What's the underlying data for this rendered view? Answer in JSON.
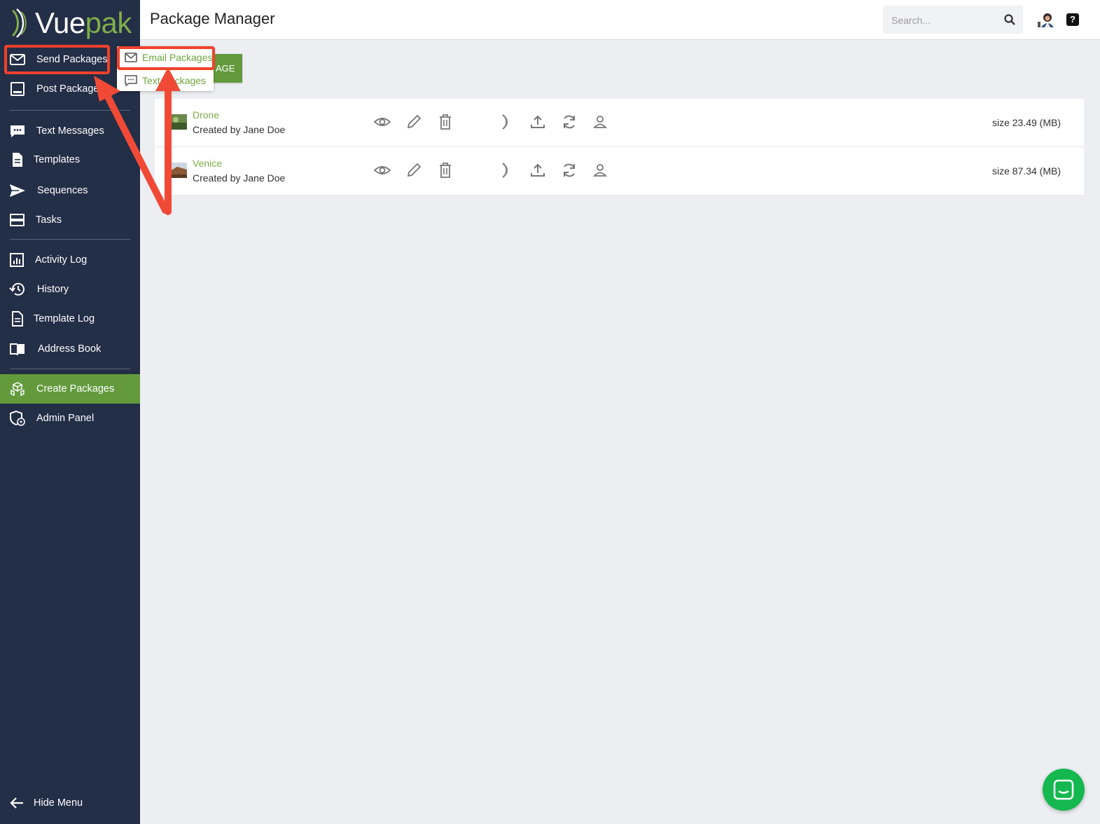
{
  "app": {
    "brand_first": "Vue",
    "brand_second": "pak"
  },
  "header": {
    "title": "Package Manager",
    "search_placeholder": "Search...",
    "help_label": "?"
  },
  "sidebar": {
    "items": [
      {
        "label": "Send Packages",
        "icon": "mail-icon"
      },
      {
        "label": "Post Packages",
        "icon": "monitor-icon"
      },
      {
        "label": "Text Messages",
        "icon": "chat-icon"
      },
      {
        "label": "Templates",
        "icon": "document-icon"
      },
      {
        "label": "Sequences",
        "icon": "send-icon"
      },
      {
        "label": "Tasks",
        "icon": "tasks-icon"
      },
      {
        "label": "Activity Log",
        "icon": "chart-icon"
      },
      {
        "label": "History",
        "icon": "history-icon"
      },
      {
        "label": "Template Log",
        "icon": "document-icon"
      },
      {
        "label": "Address Book",
        "icon": "book-icon"
      },
      {
        "label": "Create Packages",
        "icon": "boxes-icon",
        "active": true
      },
      {
        "label": "Admin Panel",
        "icon": "shield-icon"
      }
    ],
    "hide_menu": "Hide Menu"
  },
  "dropdown": {
    "items": [
      {
        "label": "Email Packages",
        "icon": "mail-icon"
      },
      {
        "label": "Text Packages",
        "icon": "chat-icon"
      }
    ]
  },
  "create_button": {
    "label": "AGE"
  },
  "packages": [
    {
      "name": "Drone",
      "creator": "Created by Jane Doe",
      "size": "size 23.49 (MB)"
    },
    {
      "name": "Venice",
      "creator": "Created by Jane Doe",
      "size": "size 87.34 (MB)"
    }
  ],
  "colors": {
    "sidebar": "#232e47",
    "accent": "#629a3c",
    "link": "#7cae4b",
    "highlight": "#f0412c",
    "chat": "#14b84f"
  }
}
